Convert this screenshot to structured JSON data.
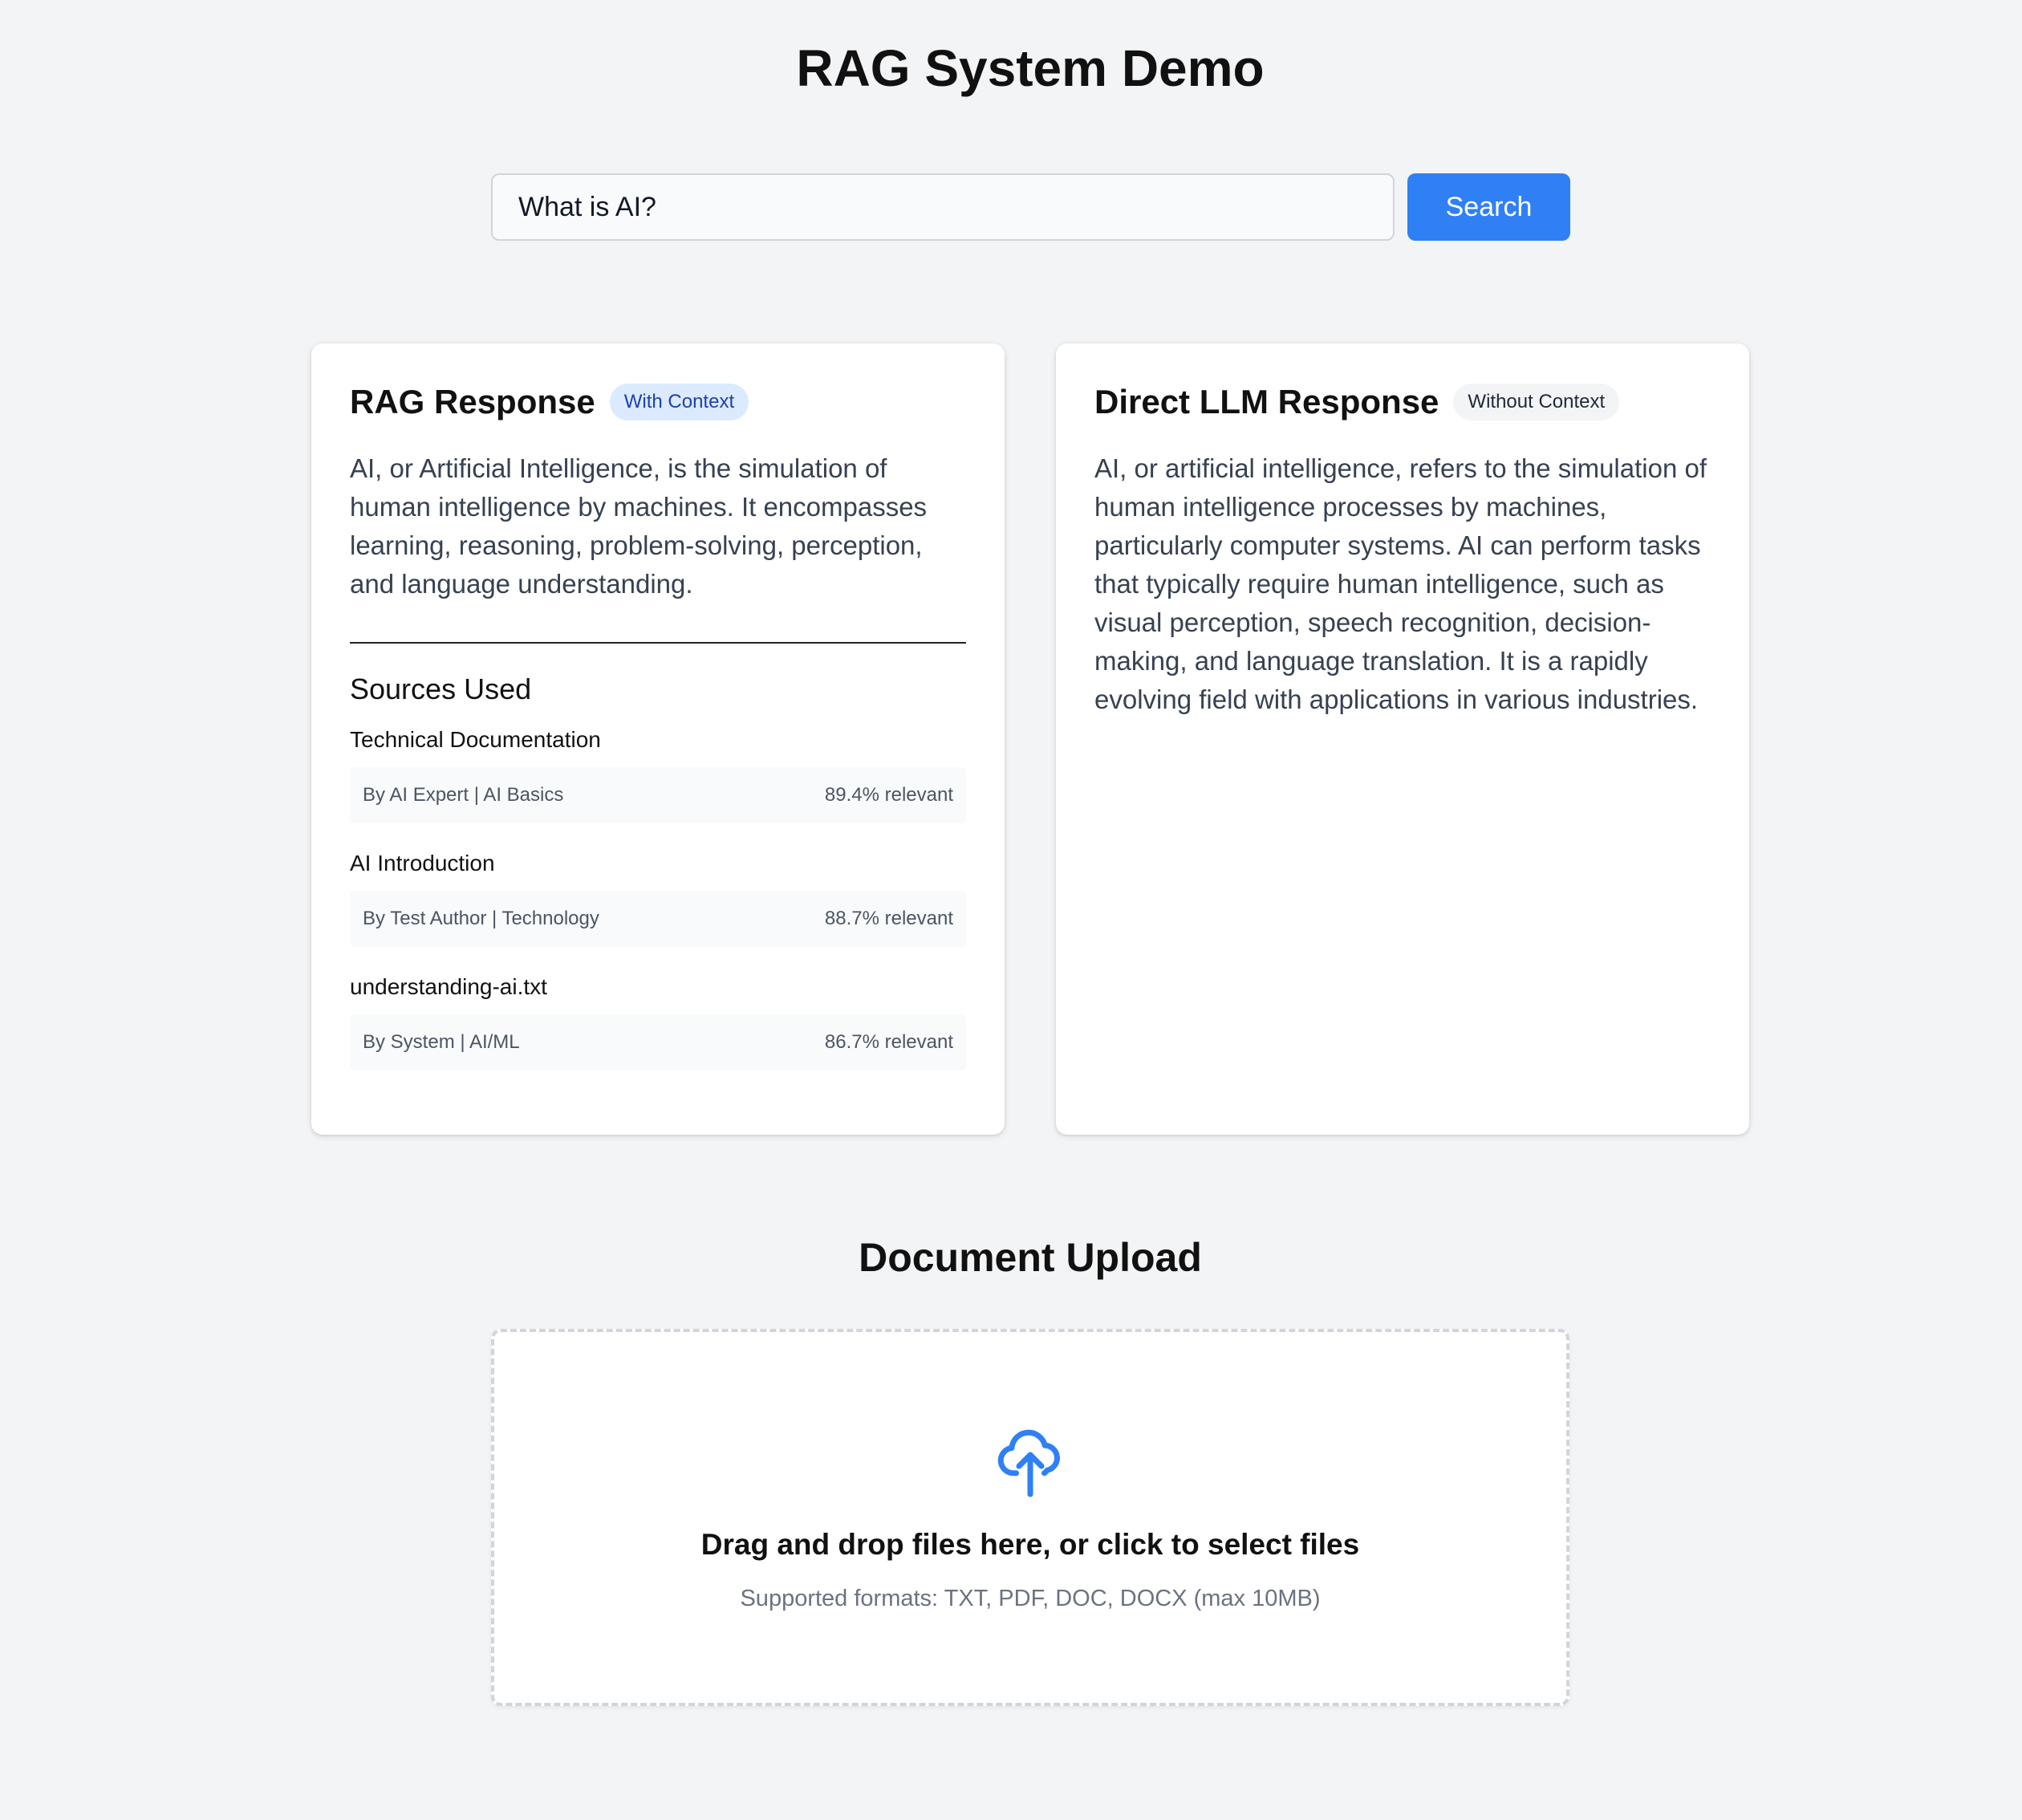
{
  "page": {
    "title": "RAG System Demo"
  },
  "search": {
    "value": "What is AI?",
    "button_label": "Search"
  },
  "rag_card": {
    "title": "RAG Response",
    "badge": "With Context",
    "response": "AI, or Artificial Intelligence, is the simulation of human intelligence by machines. It encompasses learning, reasoning, problem-solving, perception, and language understanding.",
    "sources_heading": "Sources Used",
    "sources": [
      {
        "title": "Technical Documentation",
        "meta": "By AI Expert | AI Basics",
        "relevance": "89.4% relevant"
      },
      {
        "title": "AI Introduction",
        "meta": "By Test Author | Technology",
        "relevance": "88.7% relevant"
      },
      {
        "title": "understanding-ai.txt",
        "meta": "By System | AI/ML",
        "relevance": "86.7% relevant"
      }
    ]
  },
  "llm_card": {
    "title": "Direct LLM Response",
    "badge": "Without Context",
    "response": "AI, or artificial intelligence, refers to the simulation of human intelligence processes by machines, particularly computer systems. AI can perform tasks that typically require human intelligence, such as visual perception, speech recognition, decision-making, and language translation. It is a rapidly evolving field with applications in various industries."
  },
  "upload": {
    "title": "Document Upload",
    "icon": "cloud-upload-icon",
    "drop_text": "Drag and drop files here, or click to select files",
    "formats_text": "Supported formats: TXT, PDF, DOC, DOCX (max 10MB)"
  },
  "colors": {
    "accent": "#2f80f5",
    "background": "#f3f4f6",
    "badge_context_bg": "#dbeafe",
    "badge_context_text": "#1e40af"
  }
}
